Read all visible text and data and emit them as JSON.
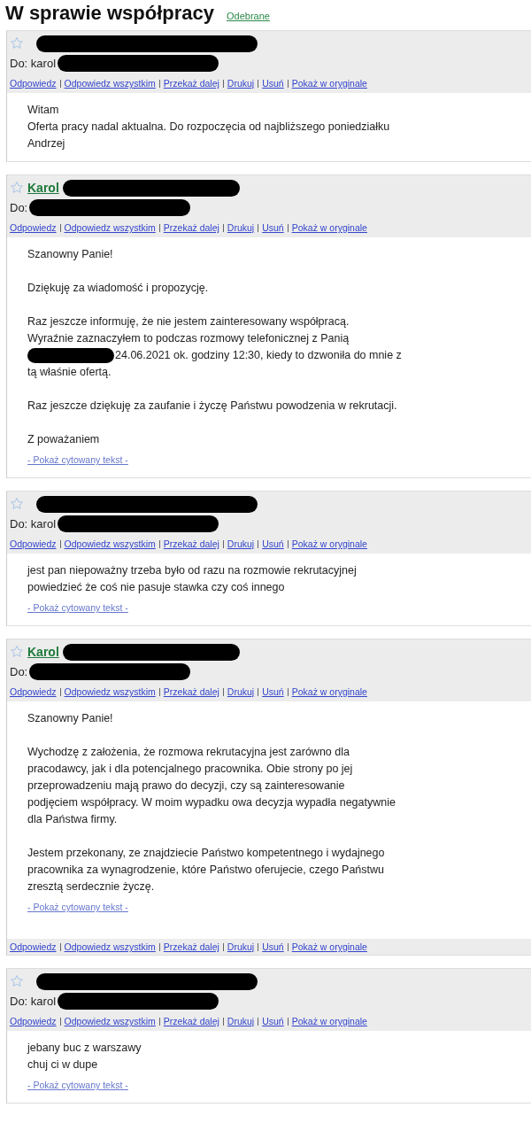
{
  "thread": {
    "title": "W sprawie współpracy",
    "label": "Odebrane"
  },
  "messages": [
    {
      "starred": false,
      "recipient": "Do: karol",
      "actions": [
        "Odpowiedz",
        "Odpowiedz wszystkim",
        "Przekaż dalej",
        "Drukuj",
        "Usuń",
        "Pokaż w oryginale"
      ],
      "body": [
        [
          "Witam",
          "Oferta pracy nadal aktualna. Do rozpoczęcia od najbliższego poniedziałku",
          "Andrzej"
        ]
      ]
    },
    {
      "starred": false,
      "sender": "Karol",
      "recipient": "Do:",
      "actions": [
        "Odpowiedz",
        "Odpowiedz wszystkim",
        "Przekaż dalej",
        "Drukuj",
        "Usuń",
        "Pokaż w oryginale"
      ],
      "body": [
        [
          "Szanowny Panie!"
        ],
        [
          "Dziękuję za wiadomość i propozycję."
        ],
        [
          "Raz jeszcze informuję, że nie jestem zainteresowany współpracą.",
          "Wyraźnie zaznaczyłem to podczas rozmowy telefonicznej z Panią",
          {
            "text": "24.06.2021 ok. godziny 12:30, kiedy to dzwoniła do mnie z",
            "redacted_before": true
          },
          "tą właśnie ofertą."
        ],
        [
          "Raz jeszcze dziękuję za zaufanie i życzę Państwu powodzenia w rekrutacji."
        ],
        [
          "Z poważaniem"
        ]
      ],
      "quote_link": "- Pokaż cytowany tekst -"
    },
    {
      "starred": false,
      "recipient": "Do: karol",
      "actions": [
        "Odpowiedz",
        "Odpowiedz wszystkim",
        "Przekaż dalej",
        "Drukuj",
        "Usuń",
        "Pokaż w oryginale"
      ],
      "body": [
        [
          "jest pan niepoważny trzeba było od razu na rozmowie rekrutacyjnej",
          "powiedzieć że coś nie pasuje stawka czy coś innego"
        ]
      ],
      "quote_link": "- Pokaż cytowany tekst -"
    },
    {
      "starred": false,
      "sender": "Karol",
      "recipient": "Do:",
      "actions": [
        "Odpowiedz",
        "Odpowiedz wszystkim",
        "Przekaż dalej",
        "Drukuj",
        "Usuń",
        "Pokaż w oryginale"
      ],
      "body": [
        [
          "Szanowny Panie!"
        ],
        [
          "Wychodzę z założenia, że rozmowa rekrutacyjna jest zarówno dla",
          "pracodawcy, jak i dla potencjalnego pracownika. Obie strony po jej",
          "przeprowadzeniu mają prawo do decyzji, czy są zainteresowanie",
          "podjęciem współpracy. W moim wypadku owa decyzja wypadła negatywnie",
          "dla Państwa firmy."
        ],
        [
          "Jestem przekonany, ze znajdziecie Państwo kompetentnego i wydajnego",
          "pracownika za wynagrodzenie, które Państwo oferujecie, czego Państwu",
          "zresztą serdecznie życzę."
        ]
      ],
      "quote_link": "- Pokaż cytowany tekst -",
      "footer_actions": [
        "Odpowiedz",
        "Odpowiedz wszystkim",
        "Przekaż dalej",
        "Drukuj",
        "Usuń",
        "Pokaż w oryginale"
      ]
    },
    {
      "starred": false,
      "recipient": "Do: karol",
      "actions": [
        "Odpowiedz",
        "Odpowiedz wszystkim",
        "Przekaż dalej",
        "Drukuj",
        "Usuń",
        "Pokaż w oryginale"
      ],
      "body": [
        [
          "jebany buc z warszawy",
          "chuj ci w dupe"
        ]
      ],
      "quote_link": "- Pokaż cytowany tekst -"
    }
  ]
}
